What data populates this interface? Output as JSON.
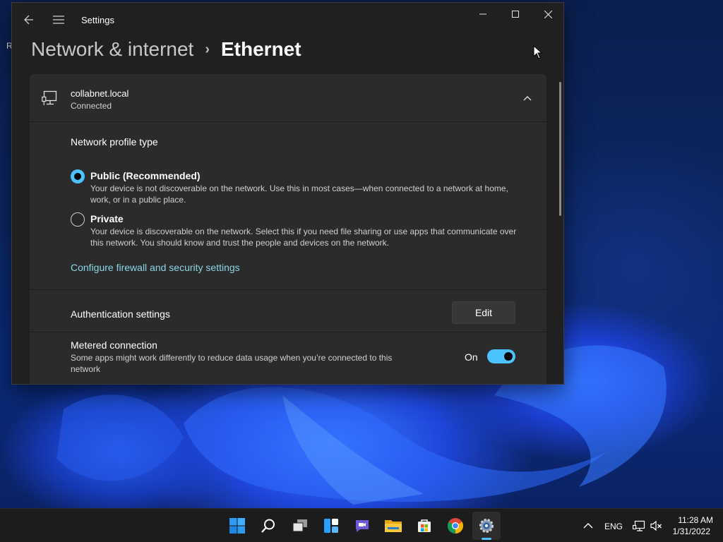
{
  "desktop": {
    "edge_text": "R"
  },
  "window": {
    "title": "Settings",
    "back_icon": "back-arrow-icon",
    "menu_icon": "hamburger-menu-icon",
    "controls": [
      "minimize-icon",
      "maximize-icon",
      "close-icon"
    ]
  },
  "breadcrumb": {
    "parent": "Network & internet",
    "separator": "›",
    "current": "Ethernet"
  },
  "network": {
    "name": "collabnet.local",
    "status": "Connected",
    "icon": "ethernet-monitor-icon"
  },
  "profile": {
    "section_title": "Network profile type",
    "options": [
      {
        "label": "Public (Recommended)",
        "description": "Your device is not discoverable on the network. Use this in most cases—when connected to a network at home, work, or in a public place.",
        "selected": true
      },
      {
        "label": "Private",
        "description": "Your device is discoverable on the network. Select this if you need file sharing or use apps that communicate over this network. You should know and trust the people and devices on the network.",
        "selected": false
      }
    ],
    "firewall_link": "Configure firewall and security settings"
  },
  "authentication": {
    "label": "Authentication settings",
    "button": "Edit"
  },
  "metered": {
    "label": "Metered connection",
    "description": "Some apps might work differently to reduce data usage when you’re connected to this network",
    "state": "On",
    "enabled": true
  },
  "taskbar": {
    "apps": [
      "start-icon",
      "search-icon",
      "task-view-icon",
      "widgets-icon",
      "chat-icon",
      "file-explorer-icon",
      "store-icon",
      "chrome-icon",
      "settings-icon"
    ],
    "active_app": "settings-icon",
    "language": "ENG",
    "time": "11:28 AM",
    "date": "1/31/2022"
  },
  "colors": {
    "accent": "#4cc2ff",
    "link": "#8bd6e6",
    "window_bg": "#202020",
    "panel_bg": "#2b2b2b"
  }
}
